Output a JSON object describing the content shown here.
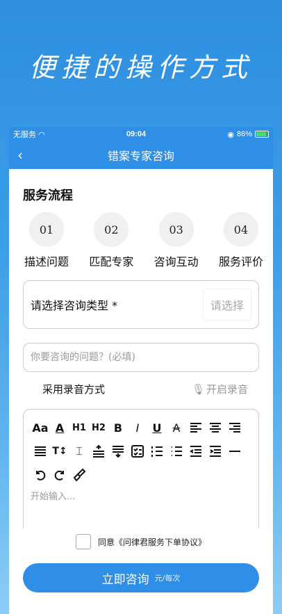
{
  "headline": "便捷的操作方式",
  "status": {
    "carrier": "无服务",
    "time": "09:04",
    "battery": "86%"
  },
  "nav": {
    "title": "错案专家咨询"
  },
  "section_title": "服务流程",
  "steps": [
    {
      "num": "01",
      "label": "描述问题"
    },
    {
      "num": "02",
      "label": "匹配专家"
    },
    {
      "num": "03",
      "label": "咨询互动"
    },
    {
      "num": "04",
      "label": "服务评价"
    }
  ],
  "select": {
    "label": "请选择咨询类型 *",
    "picker": "请选择"
  },
  "question": {
    "placeholder": "你要咨询的问题？(必填)"
  },
  "record": {
    "label": "采用录音方式",
    "button": "开启录音"
  },
  "editor": {
    "placeholder": "开始输入..."
  },
  "agree": {
    "text": "同意《问律君服务下单协议》"
  },
  "consult": {
    "label": "立即咨询",
    "unit": "元/每次"
  },
  "colors": {
    "primary": "#2f8fe6"
  }
}
